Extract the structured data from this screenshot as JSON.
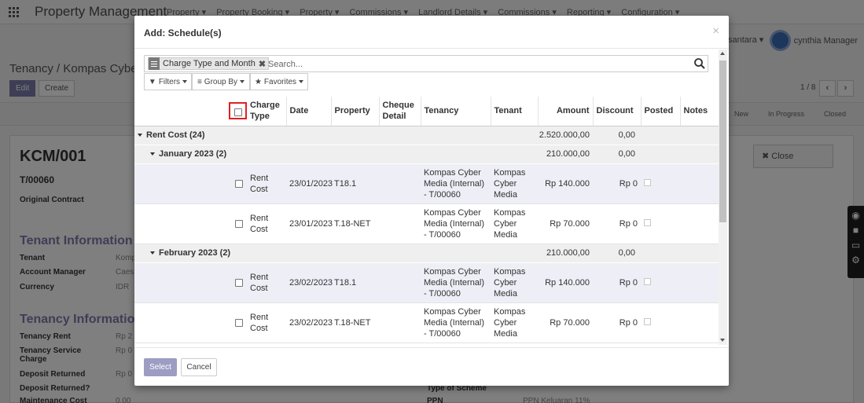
{
  "app": {
    "title": "Property Management",
    "menu": [
      "Property ▾",
      "Property Booking ▾",
      "Property ▾",
      "Commissions ▾",
      "Landlord Details ▾",
      "Commissions ▾",
      "Reporting ▾",
      "Configuration ▾"
    ],
    "company": "santara ▾",
    "user": "cynthia Manager"
  },
  "background": {
    "breadcrumb": "Tenancy /  Kompas Cyber",
    "edit_label": "Edit",
    "create_label": "Create",
    "pager": "1 / 8",
    "stages": [
      "New",
      "In Progress",
      "Closed"
    ],
    "record_name": "KCM/001",
    "record_ref": "T/00060",
    "original_contract_label": "Original Contract",
    "close_label": "Close",
    "tenant_info_title": "Tenant Information",
    "tenant_label": "Tenant",
    "tenant_value": "Komp",
    "account_manager_label": "Account Manager",
    "account_manager_value": "Caes",
    "currency_label": "Currency",
    "currency_value": "IDR",
    "tenancy_info_title": "Tenancy Information",
    "tenancy_rent_label": "Tenancy Rent",
    "tenancy_rent_value": "Rp 2",
    "tenancy_service_label": "Tenancy Service Charge",
    "tenancy_service_value": "Rp 0",
    "deposit_returned_label": "Deposit Returned",
    "deposit_returned_value": "Rp 0",
    "deposit_returned_q_label": "Deposit Returned?",
    "maintenance_label": "Maintenance Cost",
    "maintenance_value": "0,00",
    "type_scheme_label": "Type of Scheme",
    "ppn_label": "PPN",
    "ppn_value": "PPN Keluaran 11%"
  },
  "modal": {
    "title": "Add: Schedule(s)",
    "close_symbol": "×",
    "search": {
      "facet_label": "Charge Type and Month",
      "placeholder": "Search..."
    },
    "filters_label": "Filters",
    "groupby_label": "Group By",
    "favorites_label": "Favorites",
    "columns": {
      "charge_type": "Charge Type",
      "date": "Date",
      "property": "Property",
      "cheque_detail": "Cheque Detail",
      "tenancy": "Tenancy",
      "tenant": "Tenant",
      "amount": "Amount",
      "discount": "Discount",
      "posted": "Posted",
      "notes": "Notes"
    },
    "groups": {
      "top": {
        "label": "Rent Cost (24)",
        "amount": "2.520.000,00",
        "discount": "0,00"
      },
      "jan": {
        "label": "January 2023 (2)",
        "amount": "210.000,00",
        "discount": "0,00"
      },
      "feb": {
        "label": "February 2023 (2)",
        "amount": "210.000,00",
        "discount": "0,00"
      }
    },
    "rows": [
      {
        "charge_type": "Rent Cost",
        "date": "23/01/2023",
        "property": "T18.1",
        "tenancy": "Kompas Cyber Media (Internal) - T/00060",
        "tenant": "Kompas Cyber Media",
        "amount": "Rp 140.000",
        "discount": "Rp 0"
      },
      {
        "charge_type": "Rent Cost",
        "date": "23/01/2023",
        "property": "T.18-NET",
        "tenancy": "Kompas Cyber Media (Internal) - T/00060",
        "tenant": "Kompas Cyber Media",
        "amount": "Rp 70.000",
        "discount": "Rp 0"
      },
      {
        "charge_type": "Rent Cost",
        "date": "23/02/2023",
        "property": "T18.1",
        "tenancy": "Kompas Cyber Media (Internal) - T/00060",
        "tenant": "Kompas Cyber Media",
        "amount": "Rp 140.000",
        "discount": "Rp 0"
      },
      {
        "charge_type": "Rent Cost",
        "date": "23/02/2023",
        "property": "T.18-NET",
        "tenancy": "Kompas Cyber Media (Internal) - T/00060",
        "tenant": "Kompas Cyber Media",
        "amount": "Rp 70.000",
        "discount": "Rp 0"
      }
    ],
    "select_label": "Select",
    "cancel_label": "Cancel"
  }
}
